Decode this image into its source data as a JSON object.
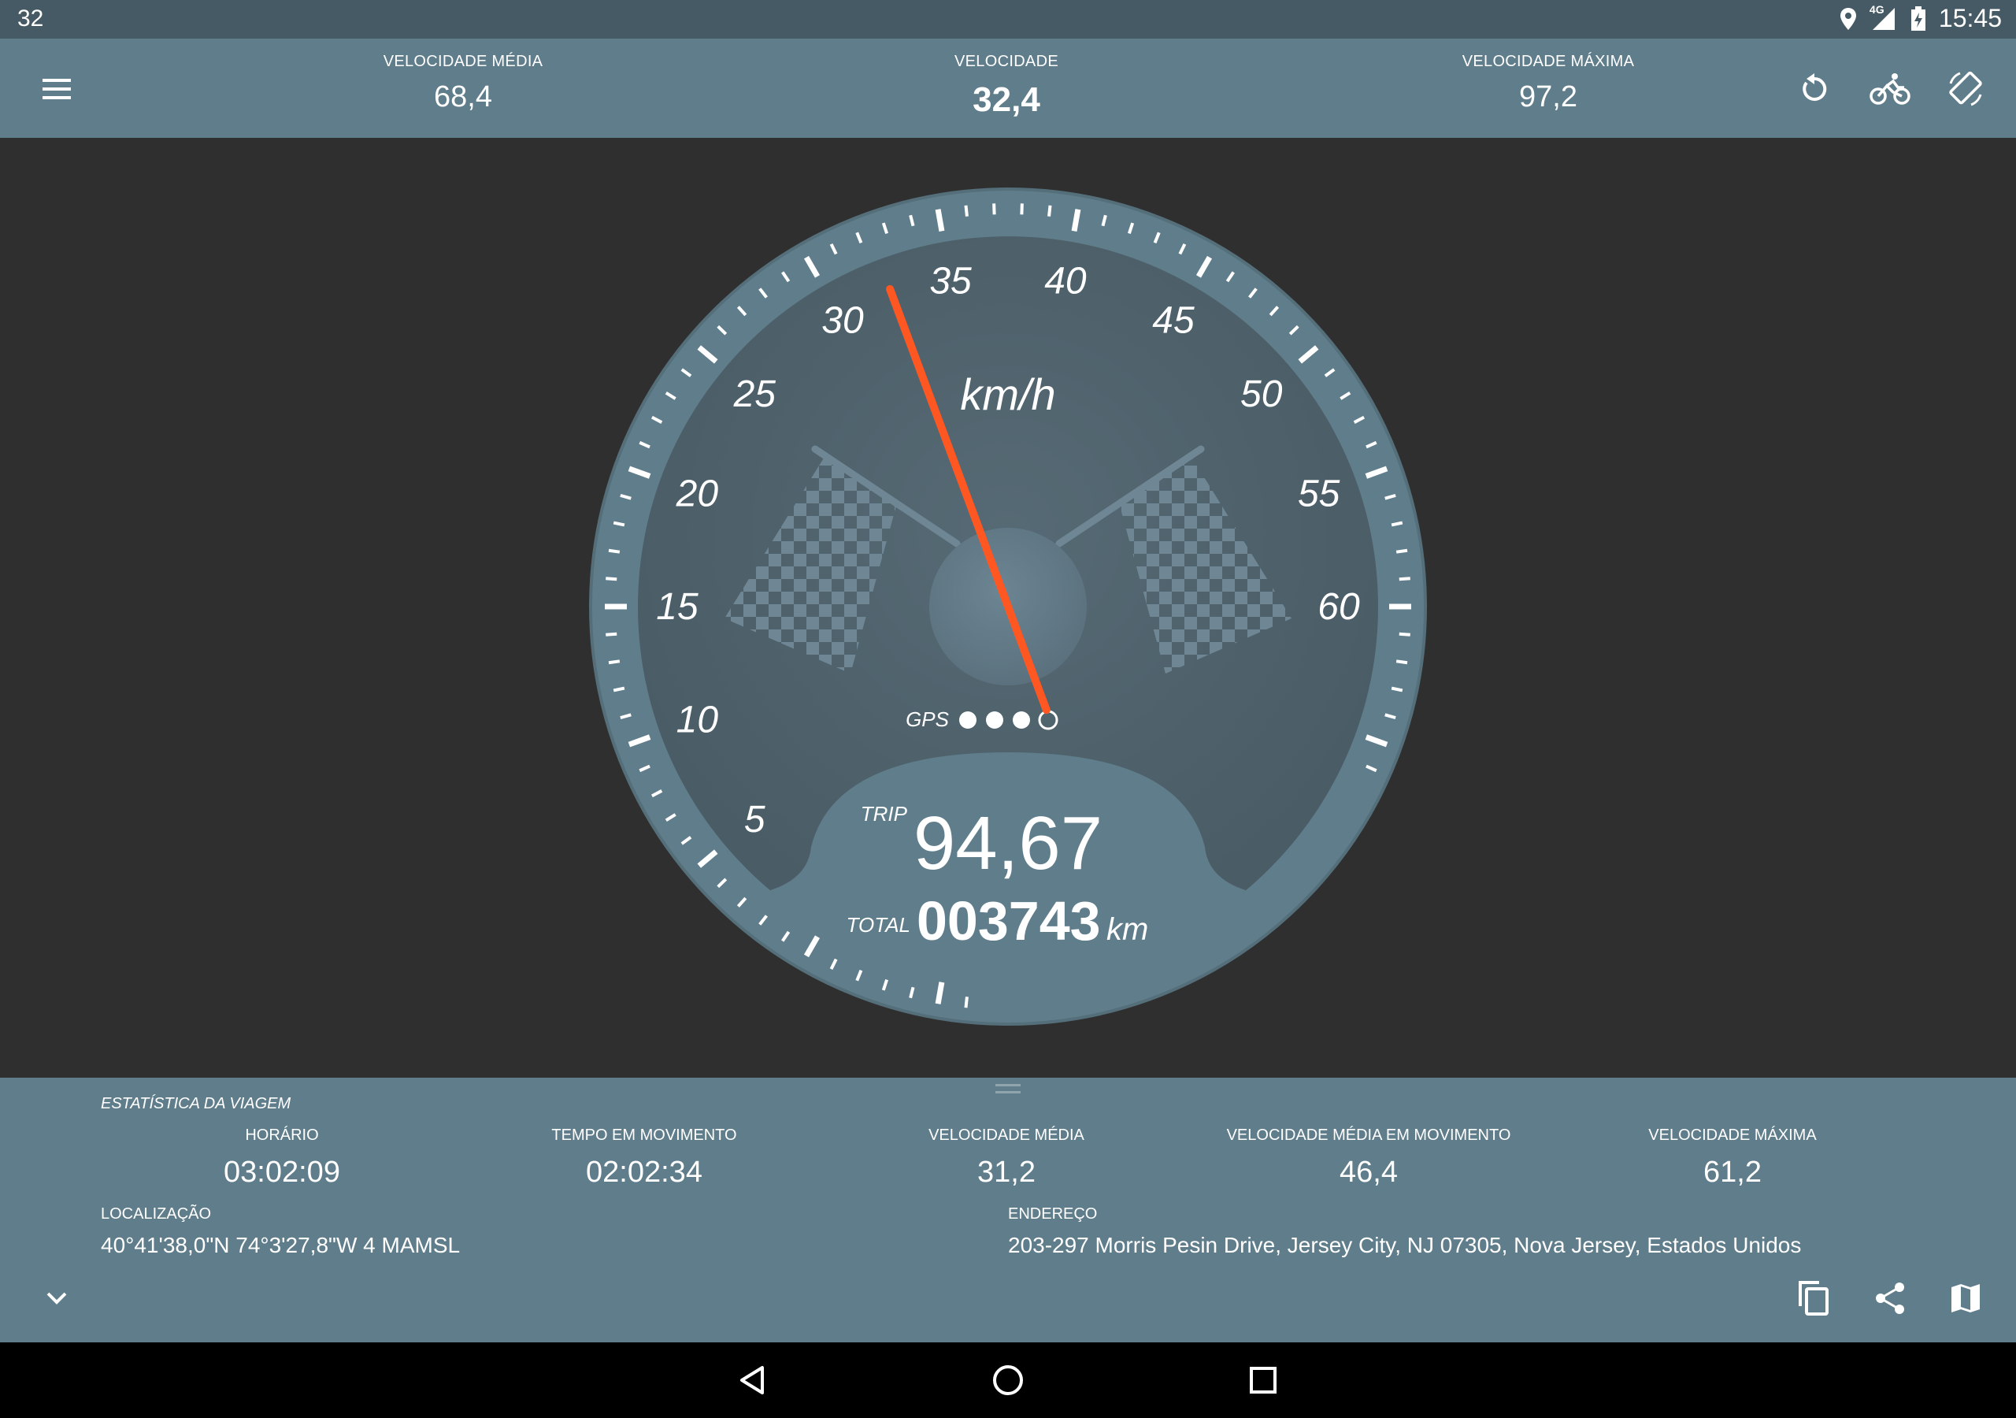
{
  "status_bar": {
    "left_text": "32",
    "network": "4G",
    "time": "15:45",
    "icons": [
      "location-icon",
      "signal-icon",
      "battery-icon"
    ]
  },
  "app_bar": {
    "avg_speed": {
      "label": "VELOCIDADE MÉDIA",
      "value": "68,4"
    },
    "speed": {
      "label": "VELOCIDADE",
      "value": "32,4"
    },
    "max_speed": {
      "label": "VELOCIDADE MÁXIMA",
      "value": "97,2"
    },
    "icons": [
      "menu-icon",
      "reset-icon",
      "bike-icon",
      "rotate-icon"
    ]
  },
  "gauge": {
    "unit": "km/h",
    "speed_value": 32.4,
    "min": 0,
    "max": 60,
    "ticks": [
      "0",
      "5",
      "10",
      "15",
      "20",
      "25",
      "30",
      "35",
      "40",
      "45",
      "50",
      "55",
      "60"
    ],
    "gps_label": "GPS",
    "gps_signal": 3,
    "gps_total": 4,
    "trip_label": "TRIP",
    "trip_value": "94,67",
    "total_label": "TOTAL",
    "total_value": "003743",
    "total_unit": "km",
    "colors": {
      "needle": "#ff5722",
      "bezel": "#607d8b",
      "face": "#4f626c"
    }
  },
  "trip_stats": {
    "title": "ESTATÍSTICA DA VIAGEM",
    "items": [
      {
        "label": "HORÁRIO",
        "value": "03:02:09"
      },
      {
        "label": "TEMPO EM MOVIMENTO",
        "value": "02:02:34"
      },
      {
        "label": "VELOCIDADE MÉDIA",
        "value": "31,2"
      },
      {
        "label": "VELOCIDADE MÉDIA EM MOVIMENTO",
        "value": "46,4"
      },
      {
        "label": "VELOCIDADE MÁXIMA",
        "value": "61,2"
      }
    ],
    "location": {
      "label": "LOCALIZAÇÃO",
      "value": "40°41'38,0\"N 74°3'27,8\"W 4 MAMSL"
    },
    "address": {
      "label": "ENDEREÇO",
      "value": "203-297 Morris Pesin Drive, Jersey City, NJ 07305, Nova Jersey, Estados Unidos"
    },
    "icons": [
      "collapse-icon",
      "copy-icon",
      "share-icon",
      "map-icon"
    ]
  },
  "nav_bar": {
    "icons": [
      "back-icon",
      "home-icon",
      "recents-icon"
    ]
  }
}
